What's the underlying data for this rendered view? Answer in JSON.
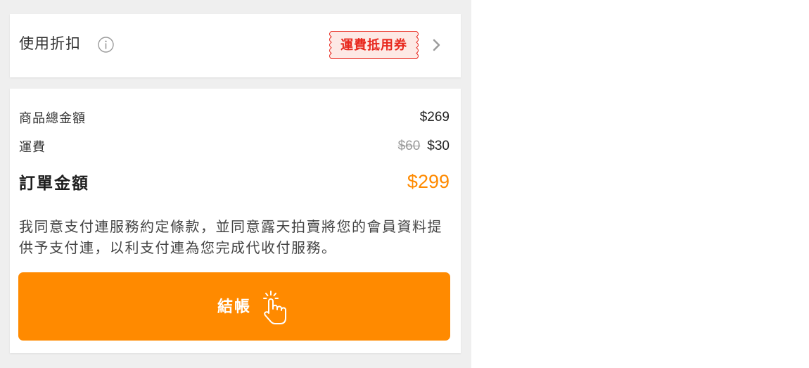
{
  "discount": {
    "label": "使用折扣",
    "info_icon": "info-circle-icon",
    "coupon_tag": "運費抵用券",
    "chevron_icon": "chevron-right-icon"
  },
  "summary": {
    "subtotal": {
      "label": "商品總金額",
      "value": "$269"
    },
    "shipping": {
      "label": "運費",
      "original_value": "$60",
      "value": "$30"
    },
    "total": {
      "label": "訂單金額",
      "value": "$299"
    }
  },
  "agreement_text": "我同意支付連服務約定條款，並同意露天拍賣將您的會員資料提供予支付連，以利支付連為您完成代收付服務。",
  "checkout": {
    "label": "結帳",
    "icon": "hand-click-icon"
  },
  "colors": {
    "accent": "#ff8a00",
    "coupon_red": "#e8281e",
    "coupon_bg": "#fde9e5",
    "page_bg": "#efefef"
  }
}
